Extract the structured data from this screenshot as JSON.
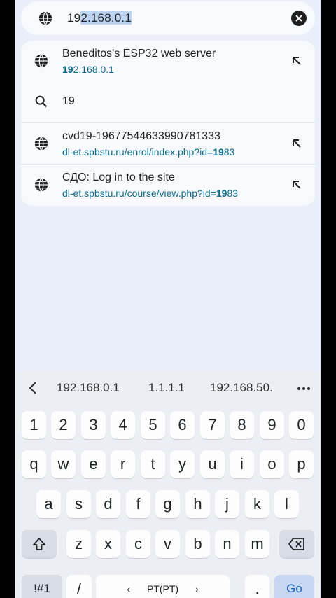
{
  "urlbar": {
    "prefix": "19",
    "selected": "2.168.0.1",
    "icon": "globe-icon",
    "clear_icon": "clear-icon"
  },
  "suggestions": [
    {
      "icon": "globe-icon",
      "title": "Beneditos's ESP32 web server",
      "url_bold": "19",
      "url_rest": "2.168.0.1",
      "arrow": "insert-arrow-icon"
    },
    {
      "icon": "search-icon",
      "title": "19"
    },
    {
      "icon": "globe-icon",
      "title": "cvd19-19677544633990781333",
      "url_pre": "dl-et.spbstu.ru/enrol/index.php?id=",
      "url_bold": "19",
      "url_post": "83",
      "arrow": "insert-arrow-icon"
    },
    {
      "icon": "globe-icon",
      "title": "СДО: Log in to the site",
      "url_pre": "dl-et.spbstu.ru/course/view.php?id=",
      "url_bold": "19",
      "url_post": "83",
      "arrow": "insert-arrow-icon"
    }
  ],
  "keyboard": {
    "toolbar_suggestions": [
      "192.168.0.1",
      "1.1.1.1",
      "192.168.50."
    ],
    "number_row": [
      "1",
      "2",
      "3",
      "4",
      "5",
      "6",
      "7",
      "8",
      "9",
      "0"
    ],
    "row1": [
      "q",
      "w",
      "e",
      "r",
      "t",
      "y",
      "u",
      "i",
      "o",
      "p"
    ],
    "row2": [
      "a",
      "s",
      "d",
      "f",
      "g",
      "h",
      "j",
      "k",
      "l"
    ],
    "row3": [
      "z",
      "x",
      "c",
      "v",
      "b",
      "n",
      "m"
    ],
    "symbols_label": "!#1",
    "slash_label": "/",
    "language_label": "PT(PT)",
    "period_label": ".",
    "go_label": "Go"
  }
}
